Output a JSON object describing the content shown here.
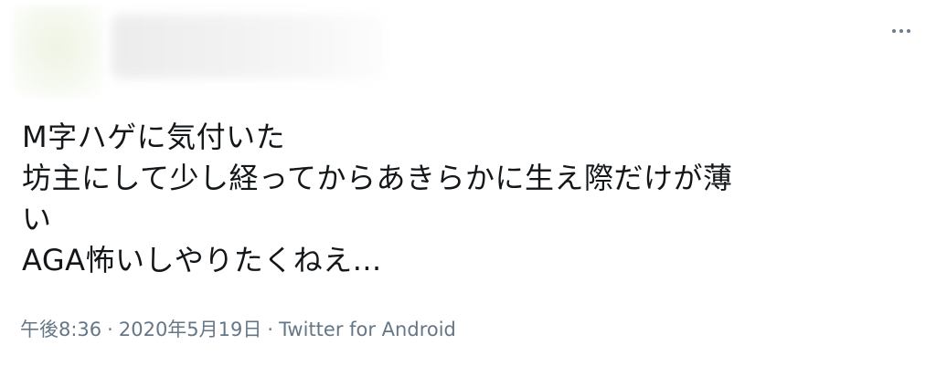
{
  "tweet": {
    "icons": {
      "more": "more-horizontal-icon"
    },
    "text_lines": [
      "M字ハゲに気付いた",
      "坊主にして少し経ってからあきらかに生え際だけが薄",
      "い",
      "AGA怖いしやりたくねえ..."
    ],
    "time": "午後8:36",
    "separator": "·",
    "date": "2020年5月19日",
    "source": "Twitter for Android"
  },
  "colors": {
    "text": "#14171a",
    "meta": "#657786",
    "icon": "#6e7b86"
  }
}
